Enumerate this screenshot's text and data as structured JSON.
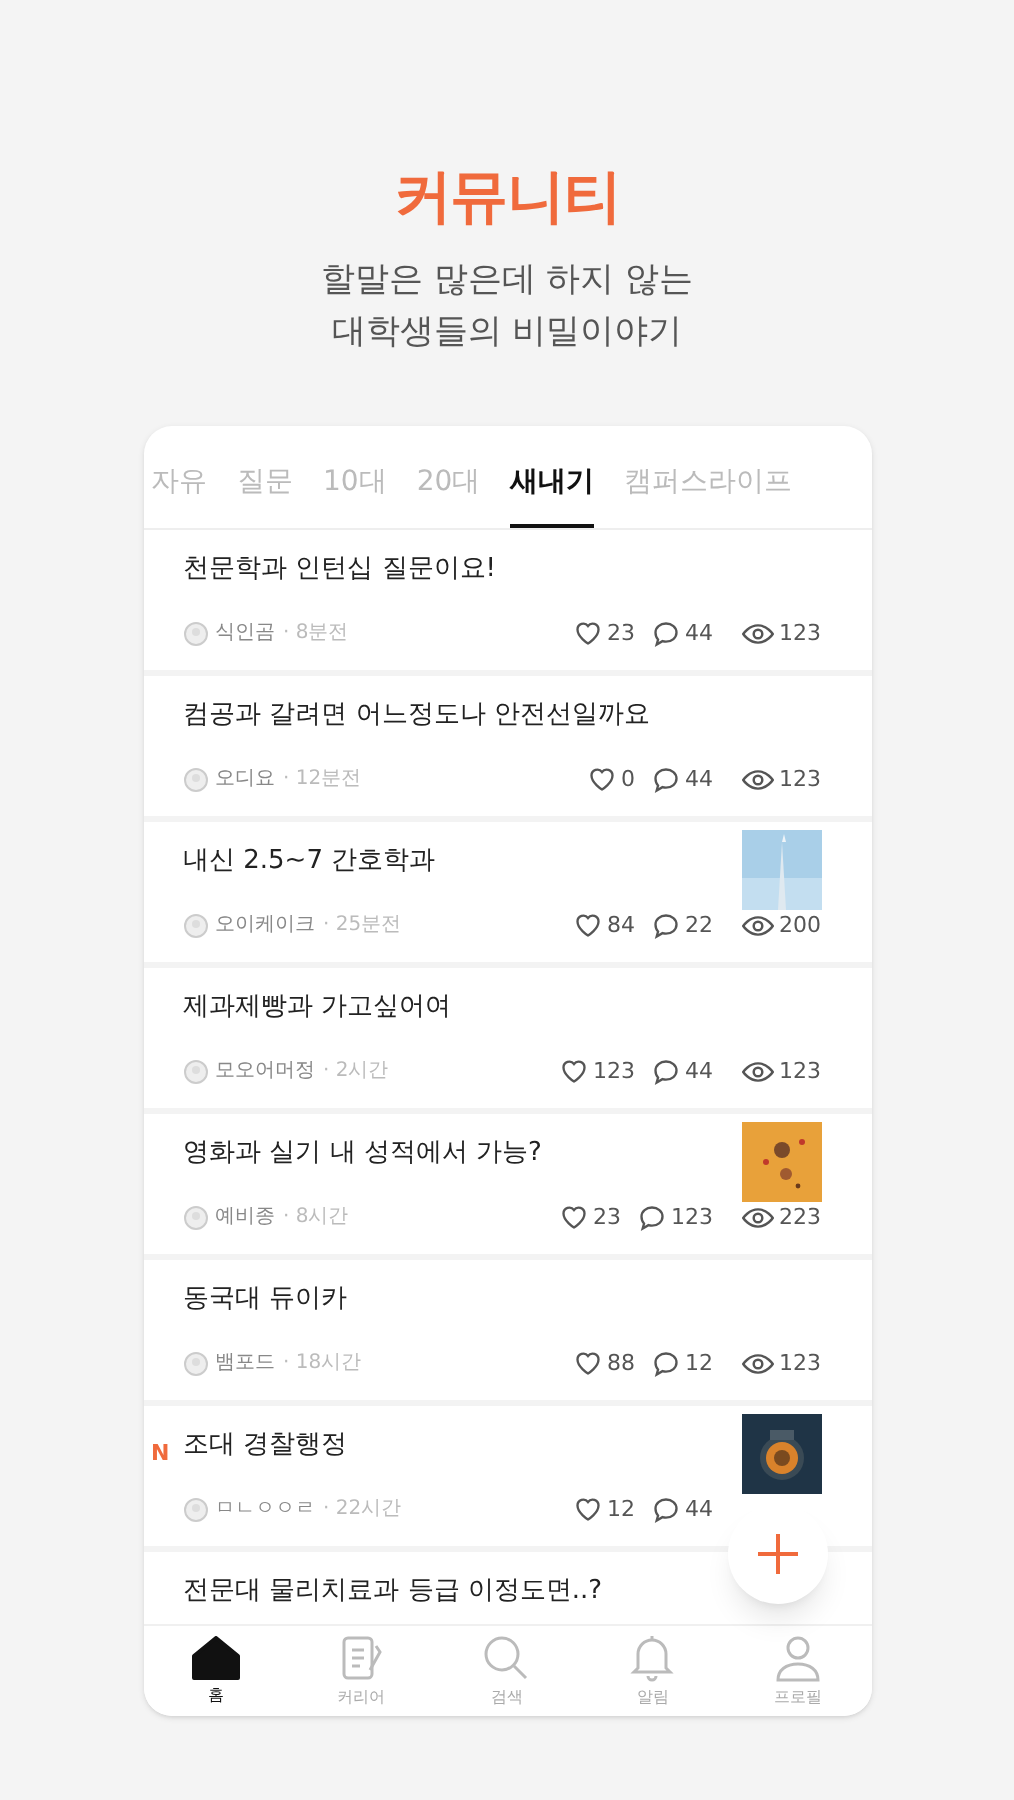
{
  "header": {
    "title": "커뮤니티",
    "subtitle_lines": [
      "할말은 많은데 하지 않는",
      "대학생들의 비밀이야기"
    ]
  },
  "tabs": [
    {
      "label": "자유",
      "selected": false
    },
    {
      "label": "질문",
      "selected": false
    },
    {
      "label": "10대",
      "selected": false
    },
    {
      "label": "20대",
      "selected": false
    },
    {
      "label": "새내기",
      "selected": true
    },
    {
      "label": "캠퍼스라이프",
      "selected": false
    }
  ],
  "posts": [
    {
      "title": "천문학과 인턴십 질문이요!",
      "author": "식인곰",
      "time": "· 8분전",
      "likes": "23",
      "comments": "44",
      "views": "123"
    },
    {
      "title": "컴공과 갈려면 어느정도나 안전선일까요",
      "author": "오디요",
      "time": "· 12분전",
      "likes": "0",
      "comments": "44",
      "views": "123"
    },
    {
      "title": "내신 2.5~7 간호학과",
      "author": "오이케이크",
      "time": "· 25분전",
      "likes": "84",
      "comments": "22",
      "views": "200",
      "kind": "picture"
    },
    {
      "title": "제과제빵과 가고싶어여",
      "author": "모오어머정",
      "time": "· 2시간",
      "likes": "123",
      "comments": "44",
      "views": "123"
    },
    {
      "title": "영화과 실기 내 성적에서 가능?",
      "author": "예비종",
      "time": "· 8시간",
      "likes": "23",
      "comments": "123",
      "views": "223",
      "kind": "picture"
    },
    {
      "title": "동국대 듀이카",
      "author": "뱀포드",
      "time": "· 18시간",
      "likes": "88",
      "comments": "12",
      "views": "123"
    },
    {
      "title": "조대 경찰행정",
      "new_mark": "N",
      "author": "ㅁㄴㅇㅇㄹ",
      "time": "· 22시간",
      "likes": "12",
      "comments": "44",
      "kind": "picture"
    },
    {
      "title": "전문대 물리치료과 등급 이정도면..?"
    }
  ],
  "nav": [
    {
      "label": "홈",
      "selected": true
    },
    {
      "label": "커리어",
      "selected": false
    },
    {
      "label": "검색",
      "selected": false
    },
    {
      "label": "알림",
      "selected": false
    },
    {
      "label": "프로필",
      "selected": false
    }
  ]
}
